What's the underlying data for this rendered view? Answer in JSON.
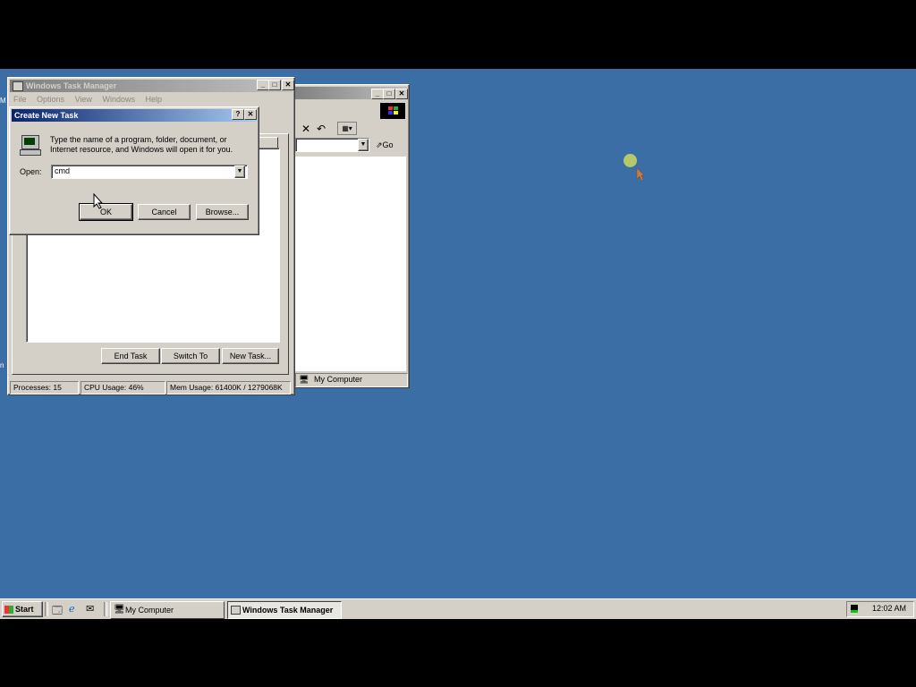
{
  "task_manager": {
    "title": "Windows Task Manager",
    "menu": [
      "File",
      "Options",
      "View",
      "Windows",
      "Help"
    ],
    "buttons": {
      "end_task": "End Task",
      "switch_to": "Switch To",
      "new_task": "New Task..."
    },
    "status": {
      "processes": "Processes: 15",
      "cpu": "CPU Usage: 46%",
      "mem": "Mem Usage: 61400K / 1279068K"
    }
  },
  "create_task": {
    "title": "Create New Task",
    "description": "Type the name of a program, folder, document, or Internet resource, and Windows will open it for you.",
    "open_label": "Open:",
    "open_value": "cmd",
    "ok": "OK",
    "cancel": "Cancel",
    "browse": "Browse..."
  },
  "my_computer": {
    "go_label": "Go",
    "status_text": "My Computer"
  },
  "taskbar": {
    "start": "Start",
    "tasks": [
      "My Computer",
      "Windows Task Manager"
    ],
    "active_task": "Windows Task Manager",
    "clock": "12:02 AM"
  },
  "colors": {
    "desktop": "#3a6ea5",
    "active_title": "#0a246a",
    "face": "#d4d0c8"
  }
}
